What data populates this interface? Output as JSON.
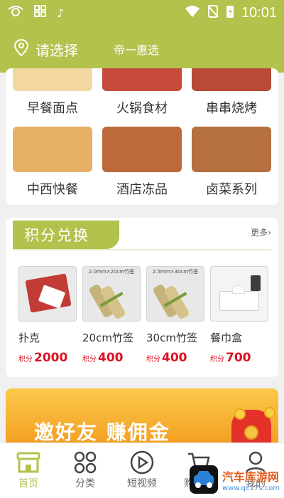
{
  "status_bar": {
    "time": "10:01",
    "icons": [
      "app-logo-icon",
      "grid-icon",
      "tiktok-icon",
      "wifi-icon",
      "no-sim-icon",
      "battery-charging-icon"
    ]
  },
  "header": {
    "location_label": "请选择",
    "brand": "帝一惠选",
    "location_icon": "location-pin-icon"
  },
  "categories": [
    {
      "label": "早餐面点",
      "color": "#f2d7a1"
    },
    {
      "label": "火锅食材",
      "color": "#c74b3b"
    },
    {
      "label": "串串烧烤",
      "color": "#b84a36"
    },
    {
      "label": "中西快餐",
      "color": "#e7b165"
    },
    {
      "label": "酒店冻品",
      "color": "#bc6a3a"
    },
    {
      "label": "卤菜系列",
      "color": "#b66f3f"
    }
  ],
  "points": {
    "title": "积分兑换",
    "more": "更多",
    "items": [
      {
        "name": "扑克",
        "price_prefix": "积分",
        "price": "2000"
      },
      {
        "name": "20cm竹签",
        "price_prefix": "积分",
        "price": "400",
        "img_label": "2.0mm×20cm竹签"
      },
      {
        "name": "30cm竹签",
        "price_prefix": "积分",
        "price": "400",
        "img_label": "2.5mm×30cm竹签"
      },
      {
        "name": "餐巾盒",
        "price_prefix": "积分",
        "price": "700"
      }
    ]
  },
  "banner": {
    "text": "邀好友 赚佣金"
  },
  "nav": [
    {
      "label": "首页",
      "icon": "store-icon",
      "active": true
    },
    {
      "label": "分类",
      "icon": "category-grid-icon",
      "active": false
    },
    {
      "label": "短视频",
      "icon": "play-circle-icon",
      "active": false
    },
    {
      "label": "购物车",
      "icon": "cart-icon",
      "active": false
    },
    {
      "label": "我的",
      "icon": "user-icon",
      "active": false
    }
  ],
  "watermark": {
    "text": "汽车库游网",
    "url": "www.qc17s.com"
  },
  "colors": {
    "brand": "#b3c24c",
    "price_red": "#d12",
    "banner_orange": "#f39b1d"
  }
}
